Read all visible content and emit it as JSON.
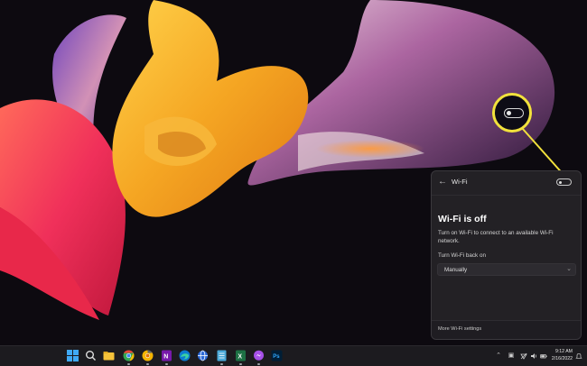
{
  "wifi_panel": {
    "title": "Wi-Fi",
    "status_heading": "Wi-Fi is off",
    "description": "Turn on Wi-Fi to connect to an available Wi-Fi network.",
    "turn_back_on_label": "Turn Wi-Fi back on",
    "turn_back_on_value": "Manually",
    "footer_link": "More Wi-Fi settings",
    "toggle_state": "off"
  },
  "callout": {
    "color": "#f2e23c"
  },
  "taskbar": {
    "apps": [
      {
        "icon": "start-windows-icon"
      },
      {
        "icon": "search-icon"
      },
      {
        "icon": "file-explorer-icon"
      },
      {
        "icon": "chrome-icon"
      },
      {
        "icon": "chrome-canary-icon"
      },
      {
        "icon": "onenote-icon"
      },
      {
        "icon": "edge-icon"
      },
      {
        "icon": "browser-globe-icon"
      },
      {
        "icon": "notepad-icon"
      },
      {
        "icon": "excel-icon"
      },
      {
        "icon": "messenger-icon"
      },
      {
        "icon": "photoshop-icon"
      }
    ],
    "tray": {
      "time": "9:12 AM",
      "date": "2/16/2022"
    }
  }
}
